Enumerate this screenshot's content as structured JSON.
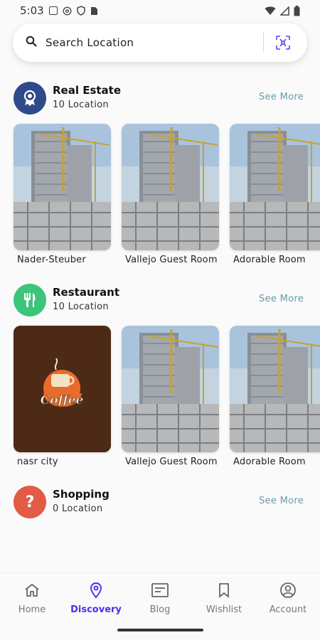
{
  "status_bar": {
    "time": "5:03"
  },
  "search": {
    "placeholder": "Search Location"
  },
  "sections": [
    {
      "title": "Real Estate",
      "subtitle": "10 Location",
      "see_more": "See More",
      "icon": "real-estate-icon",
      "color": "#2f4a8a",
      "cards": [
        {
          "label": "Nader-Steuber",
          "image": "building"
        },
        {
          "label": "Vallejo Guest Room",
          "image": "building"
        },
        {
          "label": "Adorable Room",
          "image": "building"
        }
      ]
    },
    {
      "title": "Restaurant",
      "subtitle": "10 Location",
      "see_more": "See More",
      "icon": "fork-knife-icon",
      "color": "#3cc47a",
      "cards": [
        {
          "label": "nasr city",
          "image": "coffee-logo"
        },
        {
          "label": "Vallejo Guest Room",
          "image": "building"
        },
        {
          "label": "Adorable Room",
          "image": "building"
        }
      ]
    },
    {
      "title": "Shopping",
      "subtitle": "0 Location",
      "see_more": "See More",
      "icon": "question-icon",
      "color": "#e35b45",
      "cards": []
    }
  ],
  "coffee_logo_text": "Coffee",
  "nav": {
    "items": [
      {
        "label": "Home",
        "icon": "home-icon",
        "active": false
      },
      {
        "label": "Discovery",
        "icon": "location-pin-icon",
        "active": true
      },
      {
        "label": "Blog",
        "icon": "blog-icon",
        "active": false
      },
      {
        "label": "Wishlist",
        "icon": "bookmark-icon",
        "active": false
      },
      {
        "label": "Account",
        "icon": "account-icon",
        "active": false
      }
    ]
  },
  "colors": {
    "accent": "#4a2ff0",
    "see_more": "#6a9aa8"
  }
}
